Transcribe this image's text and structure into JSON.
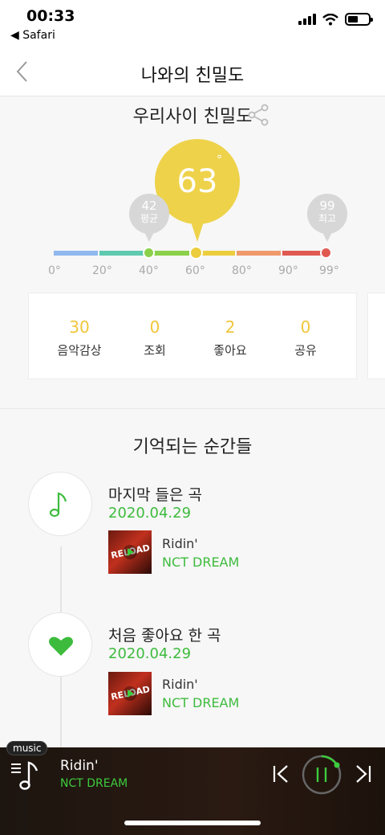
{
  "status": {
    "time": "00:33",
    "back_app": "Safari"
  },
  "nav": {
    "title": "나와의 친밀도"
  },
  "intimacy": {
    "heading": "우리사이 친밀도",
    "temperature": "63",
    "degree_symbol": "°",
    "average": {
      "value": "42",
      "label": "평균"
    },
    "max": {
      "value": "99",
      "label": "최고"
    },
    "scale_ticks": [
      "0°",
      "20°",
      "40°",
      "60°",
      "80°",
      "90°",
      "99°"
    ],
    "bar_colors": [
      "#8fb8ee",
      "#5fcab0",
      "#8bd04a",
      "#eccd3e",
      "#ee9a6a",
      "#e05a52"
    ]
  },
  "stats": [
    {
      "value": "30",
      "label": "음악감상"
    },
    {
      "value": "0",
      "label": "조회"
    },
    {
      "value": "2",
      "label": "좋아요"
    },
    {
      "value": "0",
      "label": "공유"
    }
  ],
  "moments": {
    "heading": "기억되는 순간들",
    "items": [
      {
        "icon": "music-note-icon",
        "title": "마지막 들은 곡",
        "date": "2020.04.29",
        "song": "Ridin'",
        "artist": "NCT DREAM"
      },
      {
        "icon": "heart-icon",
        "title": "처음 좋아요 한 곡",
        "date": "2020.04.29",
        "song": "Ridin'",
        "artist": "NCT DREAM"
      }
    ]
  },
  "player": {
    "tag": "music",
    "title": "Ridin'",
    "artist": "NCT DREAM"
  },
  "colors": {
    "accent_green": "#3dbb3d",
    "accent_yellow": "#eed24a"
  }
}
